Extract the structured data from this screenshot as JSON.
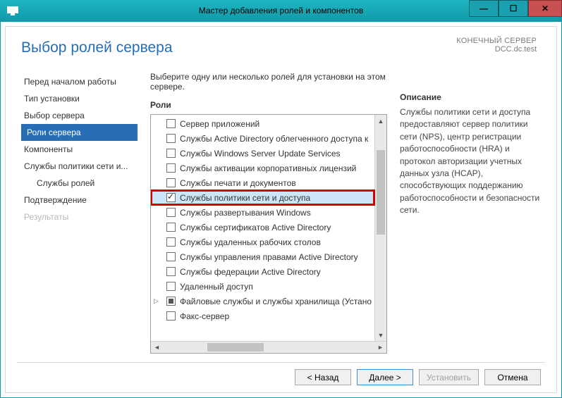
{
  "window": {
    "title": "Мастер добавления ролей и компонентов"
  },
  "header": {
    "page_title": "Выбор ролей сервера",
    "dest_label": "КОНЕЧНЫЙ СЕРВЕР",
    "dest_value": "DCC.dc.test"
  },
  "nav": {
    "items": [
      {
        "label": "Перед началом работы",
        "selected": false
      },
      {
        "label": "Тип установки",
        "selected": false
      },
      {
        "label": "Выбор сервера",
        "selected": false
      },
      {
        "label": "Роли сервера",
        "selected": true
      },
      {
        "label": "Компоненты",
        "selected": false
      },
      {
        "label": "Службы политики сети и...",
        "selected": false
      },
      {
        "label": "Службы ролей",
        "selected": false,
        "indent": true
      },
      {
        "label": "Подтверждение",
        "selected": false
      },
      {
        "label": "Результаты",
        "selected": false,
        "disabled": true
      }
    ]
  },
  "main": {
    "prompt": "Выберите одну или несколько ролей для установки на этом сервере.",
    "roles_label": "Роли",
    "desc_label": "Описание",
    "roles": [
      {
        "label": "Сервер приложений",
        "checked": false
      },
      {
        "label": "Службы Active Directory облегченного доступа к",
        "checked": false
      },
      {
        "label": "Службы Windows Server Update Services",
        "checked": false
      },
      {
        "label": "Службы активации корпоративных лицензий",
        "checked": false
      },
      {
        "label": "Службы печати и документов",
        "checked": false
      },
      {
        "label": "Службы политики сети и доступа",
        "checked": true,
        "selected": true,
        "highlighted": true
      },
      {
        "label": "Службы развертывания Windows",
        "checked": false
      },
      {
        "label": "Службы сертификатов Active Directory",
        "checked": false
      },
      {
        "label": "Службы удаленных рабочих столов",
        "checked": false
      },
      {
        "label": "Службы управления правами Active Directory",
        "checked": false
      },
      {
        "label": "Службы федерации Active Directory",
        "checked": false
      },
      {
        "label": "Удаленный доступ",
        "checked": false
      },
      {
        "label": "Файловые службы и службы хранилища (Устано",
        "checked": "square",
        "expandable": true
      },
      {
        "label": "Факс-сервер",
        "checked": false
      }
    ],
    "description": "Службы политики сети и доступа предоставляют сервер политики сети (NPS), центр регистрации работоспособности (HRA) и протокол авторизации учетных данных узла (HCAP), способствующих поддержанию работоспособности и безопасности сети."
  },
  "buttons": {
    "back": "< Назад",
    "next": "Далее >",
    "install": "Установить",
    "cancel": "Отмена"
  }
}
